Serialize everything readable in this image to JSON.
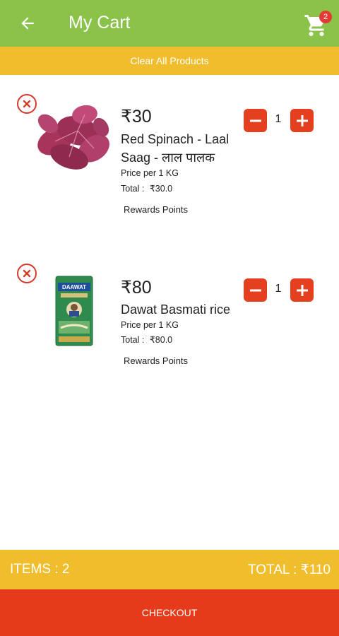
{
  "header": {
    "title": "My Cart",
    "cart_count": "2",
    "back_icon": "arrow-left-icon",
    "cart_icon": "shopping-cart-icon",
    "bar_color": "#8bc34a"
  },
  "clear_bar": {
    "label": "Clear All Products",
    "color": "#f0bd2c"
  },
  "items": [
    {
      "price": "₹30",
      "name": "Red Spinach - Laal Saag - लाल पालक",
      "unit": "Price per 1 KG",
      "total_label": "Total :",
      "total_value": "₹30.0",
      "rewards": "Rewards Points",
      "quantity": "1"
    },
    {
      "price": "₹80",
      "name": "Dawat Basmati rice",
      "unit": "Price per 1 KG",
      "total_label": "Total :",
      "total_value": "₹80.0",
      "rewards": "Rewards Points",
      "quantity": "1",
      "package_brand": "DAAWAT"
    }
  ],
  "summary": {
    "items_label": "ITEMS :  2",
    "total_label": "TOTAL :  ₹110"
  },
  "checkout": {
    "label": "CHECKOUT",
    "color": "#e53b1a"
  }
}
